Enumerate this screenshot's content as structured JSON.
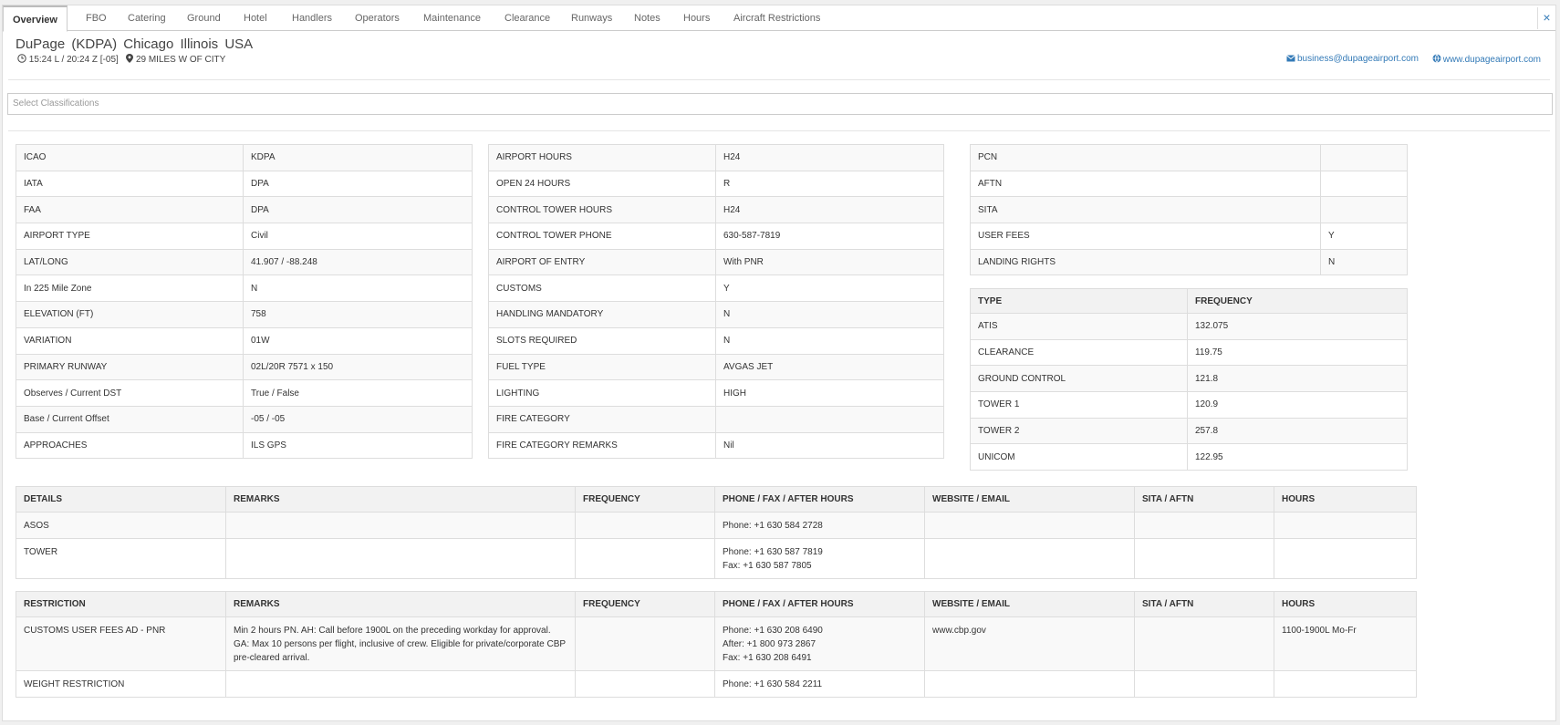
{
  "tabs": [
    "Overview",
    "FBO",
    "Catering",
    "Ground",
    "Hotel",
    "Handlers",
    "Operators",
    "Maintenance",
    "Clearance",
    "Runways",
    "Notes",
    "Hours",
    "Aircraft Restrictions"
  ],
  "close_label": "×",
  "header": {
    "title": "DuPage  (KDPA)  Chicago  Illinois USA",
    "time": "15:24 L /  20:24 Z  [-05]",
    "location": "29 MILES W OF CITY",
    "email": "business@dupageairport.com",
    "website": "www.dupageairport.com"
  },
  "classifications_placeholder": "Select Classifications",
  "table1": [
    [
      "ICAO",
      "KDPA"
    ],
    [
      "IATA",
      "DPA"
    ],
    [
      "FAA",
      "DPA"
    ],
    [
      "AIRPORT TYPE",
      "Civil"
    ],
    [
      "LAT/LONG",
      "41.907 / -88.248"
    ],
    [
      "In 225 Mile Zone",
      "N"
    ],
    [
      "ELEVATION (FT)",
      "758"
    ],
    [
      "VARIATION",
      "01W"
    ],
    [
      "PRIMARY RUNWAY",
      "02L/20R 7571 x 150"
    ],
    [
      "Observes / Current DST",
      "True / False"
    ],
    [
      "Base / Current Offset",
      "-05 / -05"
    ],
    [
      "APPROACHES",
      "ILS GPS"
    ]
  ],
  "table2": [
    [
      "AIRPORT HOURS",
      "H24"
    ],
    [
      "OPEN 24 HOURS",
      "R"
    ],
    [
      "CONTROL TOWER HOURS",
      "H24"
    ],
    [
      "CONTROL TOWER PHONE",
      "630-587-7819"
    ],
    [
      "AIRPORT OF ENTRY",
      "With PNR"
    ],
    [
      "CUSTOMS",
      "Y"
    ],
    [
      "HANDLING MANDATORY",
      "N"
    ],
    [
      "SLOTS REQUIRED",
      "N"
    ],
    [
      "FUEL TYPE",
      "AVGAS JET"
    ],
    [
      "LIGHTING",
      "HIGH"
    ],
    [
      "FIRE CATEGORY",
      ""
    ],
    [
      "FIRE CATEGORY REMARKS",
      "Nil"
    ]
  ],
  "table3": [
    [
      "PCN",
      ""
    ],
    [
      "AFTN",
      ""
    ],
    [
      "SITA",
      ""
    ],
    [
      "USER FEES",
      "Y"
    ],
    [
      "LANDING RIGHTS",
      "N"
    ]
  ],
  "freq_table": {
    "headers": [
      "TYPE",
      "FREQUENCY"
    ],
    "rows": [
      [
        "ATIS",
        "132.075"
      ],
      [
        "CLEARANCE",
        "119.75"
      ],
      [
        "GROUND CONTROL",
        "121.8"
      ],
      [
        "TOWER 1",
        "120.9"
      ],
      [
        "TOWER 2",
        "257.8"
      ],
      [
        "UNICOM",
        "122.95"
      ]
    ]
  },
  "details_table": {
    "headers": [
      "DETAILS",
      "REMARKS",
      "FREQUENCY",
      "PHONE / FAX / AFTER HOURS",
      "WEBSITE / EMAIL",
      "SITA / AFTN",
      "HOURS"
    ],
    "rows": [
      [
        "ASOS",
        "",
        "",
        "Phone: +1 630 584 2728",
        "",
        "",
        ""
      ],
      [
        "TOWER",
        "",
        "",
        "Phone: +1 630 587 7819\nFax: +1 630 587 7805",
        "",
        "",
        ""
      ]
    ]
  },
  "restriction_table": {
    "headers": [
      "RESTRICTION",
      "REMARKS",
      "FREQUENCY",
      "PHONE / FAX / AFTER HOURS",
      "WEBSITE / EMAIL",
      "SITA / AFTN",
      "HOURS"
    ],
    "rows": [
      [
        "CUSTOMS USER FEES AD - PNR",
        "Min 2 hours PN. AH: Call before 1900L on the preceding workday for approval. GA: Max 10 persons per flight, inclusive of crew. Eligible for private/corporate CBP pre-cleared arrival.",
        "",
        "Phone: +1 630 208 6490\nAfter: +1 800 973 2867\nFax: +1 630 208 6491",
        "www.cbp.gov",
        "",
        "1100-1900L Mo-Fr"
      ],
      [
        "WEIGHT RESTRICTION",
        "",
        "",
        "Phone: +1 630 584 2211",
        "",
        "",
        ""
      ]
    ]
  },
  "colors": {
    "link": "#337ab7",
    "border": "#dddddd",
    "header_bg": "#f2f2f2"
  }
}
